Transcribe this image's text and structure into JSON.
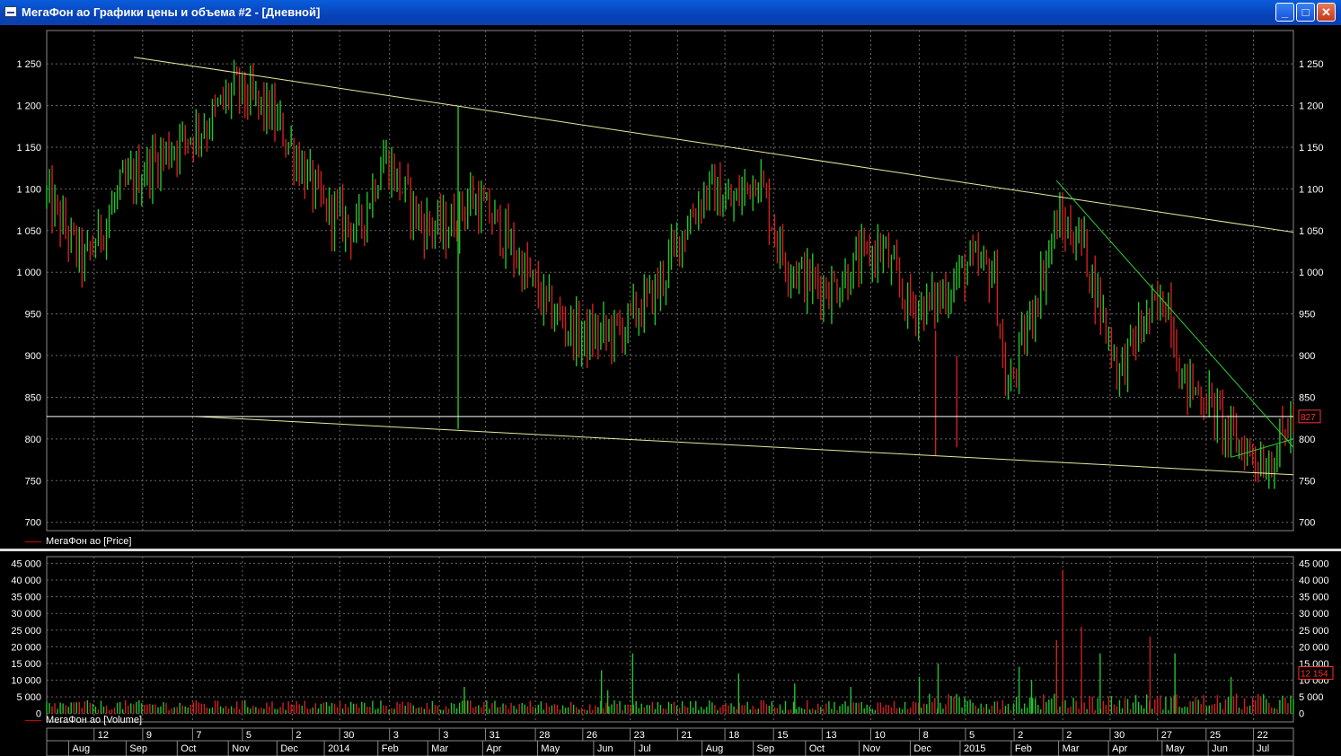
{
  "window": {
    "title": "МегаФон ао Графики цены и объема #2 - [Дневной]",
    "minimize_label": "_",
    "maximize_label": "□",
    "close_label": "✕"
  },
  "colors": {
    "up": "#22c42a",
    "down": "#d21f1f",
    "grid": "#6a6a6a",
    "trendline_yellow": "#e8e8a0",
    "trendline_green": "#2fd02f",
    "price_tag": "#ff3030"
  },
  "legends": {
    "price": "МегаФон ао [Price]",
    "volume": "МегаФон ао [Volume]"
  },
  "price_tag": "827",
  "volume_tag": "12 154",
  "chart_data": [
    {
      "type": "candlestick",
      "title": "",
      "series_name": "МегаФон ао [Price]",
      "ylim": [
        690,
        1290
      ],
      "y_ticks": [
        "700",
        "750",
        "800",
        "850",
        "900",
        "950",
        "1 000",
        "1 050",
        "1 100",
        "1 150",
        "1 200",
        "1 250"
      ],
      "y_tick_values": [
        700,
        750,
        800,
        850,
        900,
        950,
        1000,
        1050,
        1100,
        1150,
        1200,
        1250
      ],
      "last_value": 827,
      "trendlines": [
        {
          "from": [
            0.07,
            1258
          ],
          "to": [
            1.0,
            1048
          ],
          "color": "yellow"
        },
        {
          "from": [
            0.12,
            827
          ],
          "to": [
            1.0,
            757
          ],
          "color": "yellow"
        },
        {
          "from": [
            0.0,
            827
          ],
          "to": [
            1.0,
            827
          ],
          "color": "white"
        },
        {
          "from": [
            0.81,
            1110
          ],
          "to": [
            1.0,
            790
          ],
          "color": "green"
        },
        {
          "from": [
            0.95,
            778
          ],
          "to": [
            1.0,
            800
          ],
          "color": "green"
        }
      ],
      "anchors": [
        [
          0.0,
          1090
        ],
        [
          0.03,
          1010
        ],
        [
          0.06,
          1100
        ],
        [
          0.1,
          1150
        ],
        [
          0.13,
          1180
        ],
        [
          0.15,
          1220
        ],
        [
          0.18,
          1190
        ],
        [
          0.2,
          1140
        ],
        [
          0.22,
          1080
        ],
        [
          0.25,
          1050
        ],
        [
          0.27,
          1140
        ],
        [
          0.3,
          1060
        ],
        [
          0.32,
          1050
        ],
        [
          0.34,
          1090
        ],
        [
          0.36,
          1060
        ],
        [
          0.4,
          960
        ],
        [
          0.43,
          920
        ],
        [
          0.46,
          930
        ],
        [
          0.49,
          980
        ],
        [
          0.51,
          1050
        ],
        [
          0.53,
          1100
        ],
        [
          0.55,
          1080
        ],
        [
          0.57,
          1120
        ],
        [
          0.59,
          1020
        ],
        [
          0.61,
          990
        ],
        [
          0.63,
          980
        ],
        [
          0.65,
          1010
        ],
        [
          0.67,
          1030
        ],
        [
          0.69,
          960
        ],
        [
          0.71,
          960
        ],
        [
          0.74,
          1010
        ],
        [
          0.76,
          1000
        ],
        [
          0.77,
          850
        ],
        [
          0.79,
          950
        ],
        [
          0.81,
          1060
        ],
        [
          0.83,
          1040
        ],
        [
          0.86,
          880
        ],
        [
          0.88,
          940
        ],
        [
          0.9,
          970
        ],
        [
          0.91,
          870
        ],
        [
          0.93,
          850
        ],
        [
          0.95,
          800
        ],
        [
          0.97,
          780
        ],
        [
          0.98,
          770
        ],
        [
          1.0,
          827
        ]
      ]
    },
    {
      "type": "bar",
      "title": "",
      "series_name": "МегаФон ао [Volume]",
      "ylim": [
        -2500,
        47000
      ],
      "y_ticks": [
        "0",
        "5 000",
        "10 000",
        "15 000",
        "20 000",
        "25 000",
        "30 000",
        "35 000",
        "40 000",
        "45 000"
      ],
      "y_tick_values": [
        0,
        5000,
        10000,
        15000,
        20000,
        25000,
        30000,
        35000,
        40000,
        45000
      ],
      "last_value": 12154,
      "spikes": [
        [
          0.335,
          8000
        ],
        [
          0.45,
          7000
        ],
        [
          0.445,
          13000
        ],
        [
          0.47,
          18000
        ],
        [
          0.555,
          12000
        ],
        [
          0.6,
          9000
        ],
        [
          0.645,
          8000
        ],
        [
          0.7,
          11000
        ],
        [
          0.715,
          15000
        ],
        [
          0.78,
          14000
        ],
        [
          0.79,
          10000
        ],
        [
          0.81,
          22000
        ],
        [
          0.815,
          43000
        ],
        [
          0.83,
          26000
        ],
        [
          0.845,
          18000
        ],
        [
          0.885,
          23000
        ],
        [
          0.905,
          18000
        ],
        [
          0.95,
          11000
        ]
      ]
    }
  ],
  "x_axis": {
    "days": [
      {
        "label": "12",
        "pos": 0.038
      },
      {
        "label": "9",
        "pos": 0.077
      },
      {
        "label": "7",
        "pos": 0.117
      },
      {
        "label": "5",
        "pos": 0.157
      },
      {
        "label": "2",
        "pos": 0.197
      },
      {
        "label": "30",
        "pos": 0.235
      },
      {
        "label": "3",
        "pos": 0.275
      },
      {
        "label": "3",
        "pos": 0.315
      },
      {
        "label": "31",
        "pos": 0.352
      },
      {
        "label": "28",
        "pos": 0.392
      },
      {
        "label": "26",
        "pos": 0.43
      },
      {
        "label": "23",
        "pos": 0.468
      },
      {
        "label": "21",
        "pos": 0.506
      },
      {
        "label": "18",
        "pos": 0.544
      },
      {
        "label": "15",
        "pos": 0.583
      },
      {
        "label": "13",
        "pos": 0.622
      },
      {
        "label": "10",
        "pos": 0.661
      },
      {
        "label": "8",
        "pos": 0.7
      },
      {
        "label": "5",
        "pos": 0.737
      },
      {
        "label": "2",
        "pos": 0.776
      },
      {
        "label": "2",
        "pos": 0.815
      },
      {
        "label": "30",
        "pos": 0.853
      },
      {
        "label": "27",
        "pos": 0.891
      },
      {
        "label": "25",
        "pos": 0.93
      },
      {
        "label": "22",
        "pos": 0.968
      }
    ],
    "months": [
      {
        "label": "Aug",
        "pos": 0.022
      },
      {
        "label": "Sep",
        "pos": 0.068
      },
      {
        "label": "Oct",
        "pos": 0.109
      },
      {
        "label": "Nov",
        "pos": 0.15
      },
      {
        "label": "Dec",
        "pos": 0.189
      },
      {
        "label": "2014",
        "pos": 0.227
      },
      {
        "label": "Feb",
        "pos": 0.27
      },
      {
        "label": "Mar",
        "pos": 0.31
      },
      {
        "label": "Apr",
        "pos": 0.354
      },
      {
        "label": "May",
        "pos": 0.398
      },
      {
        "label": "Jun",
        "pos": 0.443
      },
      {
        "label": "Jul",
        "pos": 0.476
      },
      {
        "label": "Aug",
        "pos": 0.53
      },
      {
        "label": "Sep",
        "pos": 0.571
      },
      {
        "label": "Oct",
        "pos": 0.613
      },
      {
        "label": "Nov",
        "pos": 0.656
      },
      {
        "label": "Dec",
        "pos": 0.697
      },
      {
        "label": "2015",
        "pos": 0.737
      },
      {
        "label": "Feb",
        "pos": 0.778
      },
      {
        "label": "Mar",
        "pos": 0.816
      },
      {
        "label": "Apr",
        "pos": 0.856
      },
      {
        "label": "May",
        "pos": 0.899
      },
      {
        "label": "Jun",
        "pos": 0.936
      },
      {
        "label": "Jul",
        "pos": 0.972
      }
    ]
  }
}
